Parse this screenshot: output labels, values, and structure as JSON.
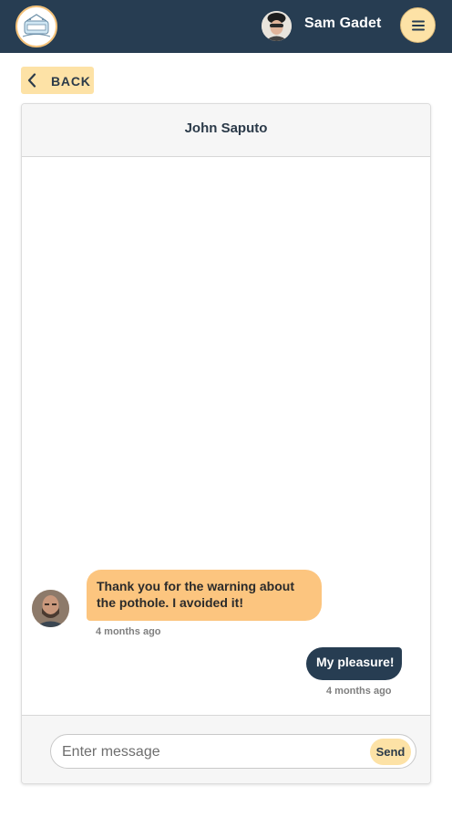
{
  "header": {
    "logo_icon": "community-logo-icon",
    "user_name": "Sam Gadet",
    "menu_icon": "hamburger-menu-icon"
  },
  "navigation": {
    "back_label": "BACK",
    "back_icon": "chevron-left-icon"
  },
  "chat": {
    "title": "John Saputo",
    "messages": [
      {
        "direction": "incoming",
        "text": "Thank you for the warning about the pothole. I avoided it!",
        "time": "4 months ago"
      },
      {
        "direction": "outgoing",
        "text": "My pleasure!",
        "time": "4 months ago"
      }
    ],
    "composer": {
      "placeholder": "Enter message",
      "value": "",
      "send_label": "Send"
    }
  },
  "colors": {
    "topbar": "#273d52",
    "accent": "#fde2a6",
    "incoming_bubble": "#fcc57f",
    "outgoing_bubble": "#273d52"
  }
}
